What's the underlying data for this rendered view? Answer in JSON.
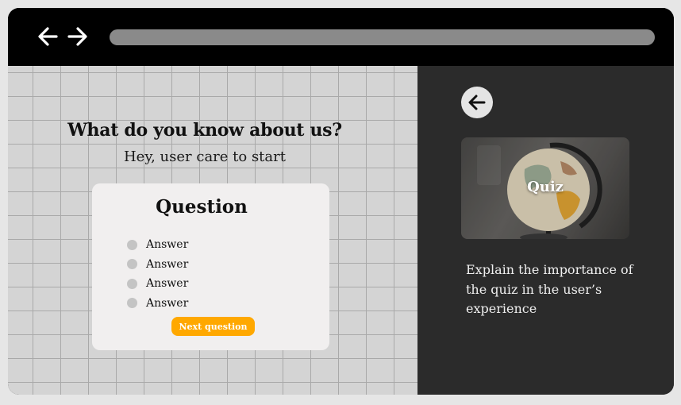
{
  "browser": {
    "back_icon": "arrow-left-icon",
    "forward_icon": "arrow-right-icon",
    "address_value": ""
  },
  "left": {
    "title": "What do you know about us?",
    "subtitle": "Hey, user care to start",
    "card": {
      "question": "Question",
      "answers": [
        "Answer",
        "Answer",
        "Answer",
        "Answer"
      ],
      "next_label": "Next question"
    }
  },
  "right": {
    "back_icon": "arrow-left-circle-icon",
    "image_label": "Quiz",
    "description": "Explain the importance of the quiz in the user’s experience"
  },
  "colors": {
    "toolbar": "#000000",
    "left_bg": "#d4d4d4",
    "right_bg": "#2b2b2b",
    "accent": "#ffa800",
    "card_bg": "#f1efef"
  }
}
